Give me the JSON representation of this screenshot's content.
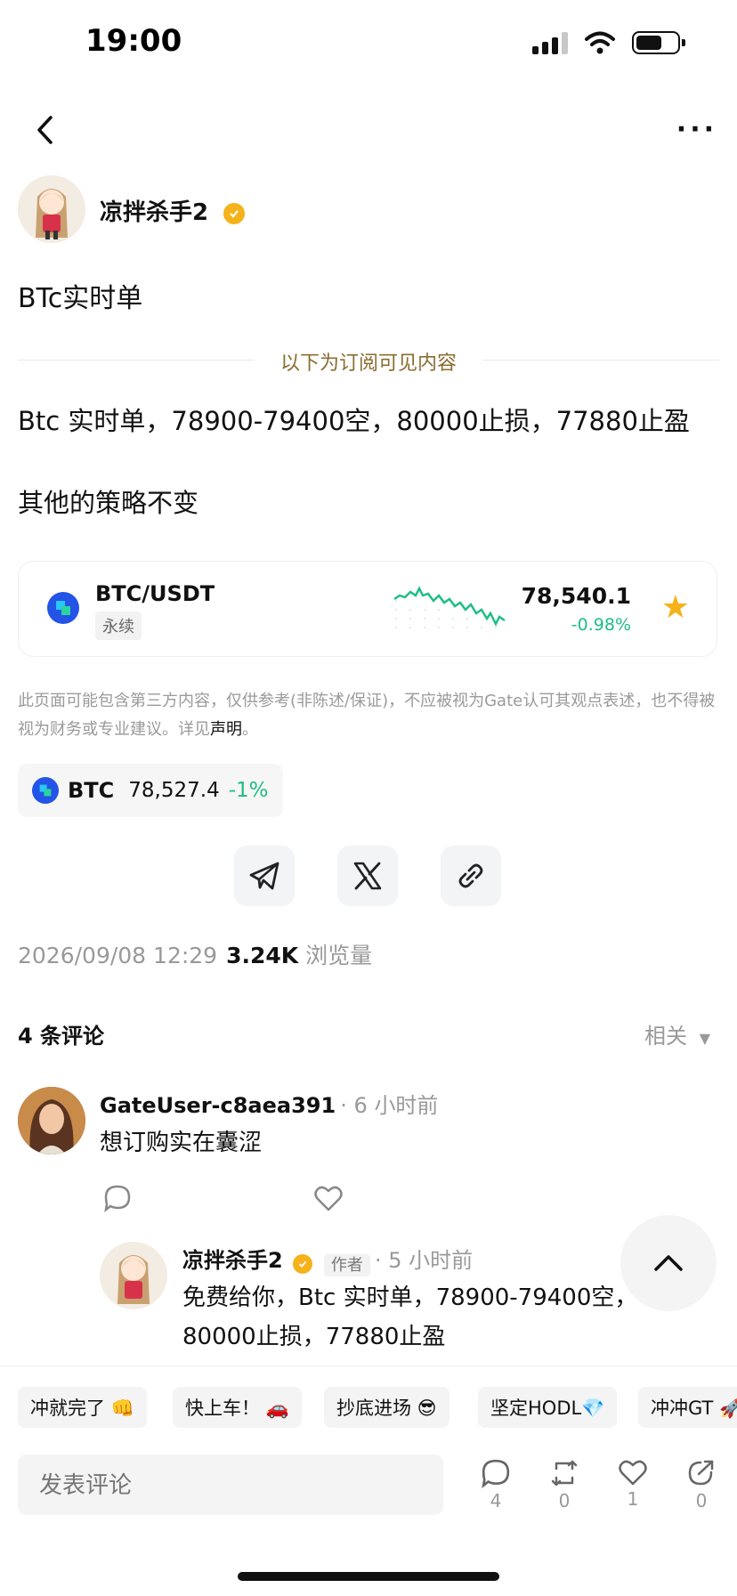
{
  "status_bar": {
    "time": "19:00"
  },
  "author": {
    "name": "凉拌杀手2"
  },
  "post": {
    "title": "BTc实时单",
    "subscriber_divider": "以下为订阅可见内容",
    "line1": "Btc 实时单，78900-79400空，80000止损，77880止盈",
    "line2": "其他的策略不变"
  },
  "ticker_card": {
    "pair": "BTC/USDT",
    "badge": "永续",
    "price": "78,540.1",
    "change": "-0.98%"
  },
  "disclaimer": {
    "text": "此页面可能包含第三方内容，仅供参考(非陈述/保证)，不应被视为Gate认可其观点表述，也不得被视为财务或专业建议。详见",
    "link": "声明",
    "end": "。"
  },
  "btc_chip": {
    "symbol": "BTC",
    "price": "78,527.4",
    "change": "-1%"
  },
  "meta": {
    "datetime": "2026/09/08 12:29",
    "views": "3.24K",
    "views_label": "浏览量"
  },
  "comments": {
    "header": "4 条评论",
    "sort": "相关",
    "items": [
      {
        "user": "GateUser-c8aea391",
        "time": "· 6 小时前",
        "text": "想订购实在囊涩"
      }
    ],
    "reply": {
      "user": "凉拌杀手2",
      "tag": "作者",
      "time": "· 5 小时前",
      "text_line1": "免费给你，Btc 实时单，78900-79400空，",
      "text_line2": "80000止损，77880止盈"
    }
  },
  "quick_replies": [
    "冲就完了 👊",
    "快上车！ 🚗",
    "抄底进场 😎",
    "坚定HODL💎",
    "冲冲GT 🚀"
  ],
  "composer": {
    "placeholder": "发表评论"
  },
  "actions": {
    "comments": "4",
    "reposts": "0",
    "likes": "1",
    "shares": "0"
  },
  "colors": {
    "green": "#1ebe84",
    "gold": "#f5b21a",
    "gate_blue": "#2354e6"
  }
}
